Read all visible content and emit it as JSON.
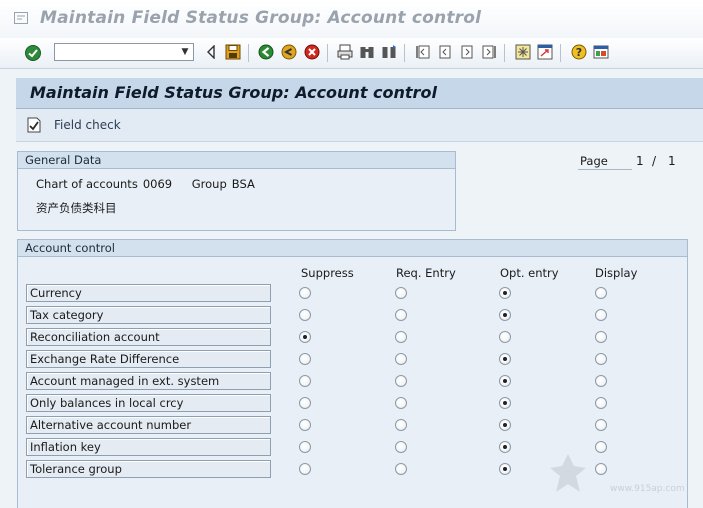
{
  "window": {
    "title": "Maintain Field Status Group: Account control"
  },
  "toolbar": {
    "command_placeholder": "",
    "command_value": ""
  },
  "screen": {
    "title": "Maintain Field Status Group: Account control",
    "field_check_label": "Field check"
  },
  "general_data": {
    "heading": "General Data",
    "chart_of_accounts_label": "Chart of accounts",
    "chart_of_accounts_value": "0069",
    "group_label": "Group",
    "group_value": "BSA",
    "group_text": "资产负债类科目"
  },
  "paging": {
    "label": "Page",
    "current": "1",
    "separator": "/",
    "total": "1"
  },
  "account_control": {
    "heading": "Account control",
    "columns": [
      "Suppress",
      "Req. Entry",
      "Opt. entry",
      "Display"
    ],
    "rows": [
      {
        "label": "Currency",
        "selected": 2
      },
      {
        "label": "Tax category",
        "selected": 2
      },
      {
        "label": "Reconciliation account",
        "selected": 0
      },
      {
        "label": "Exchange Rate Difference",
        "selected": 2
      },
      {
        "label": "Account managed in ext. system",
        "selected": 2
      },
      {
        "label": "Only balances in local crcy",
        "selected": 2
      },
      {
        "label": "Alternative account number",
        "selected": 2
      },
      {
        "label": "Inflation key",
        "selected": 2
      },
      {
        "label": "Tolerance group",
        "selected": 2
      }
    ]
  },
  "watermark": {
    "url": "www.915ap.com"
  },
  "colors": {
    "title_bar": "#c6d7ea",
    "group_header": "#d3e1ee",
    "background": "#eef3f8"
  }
}
